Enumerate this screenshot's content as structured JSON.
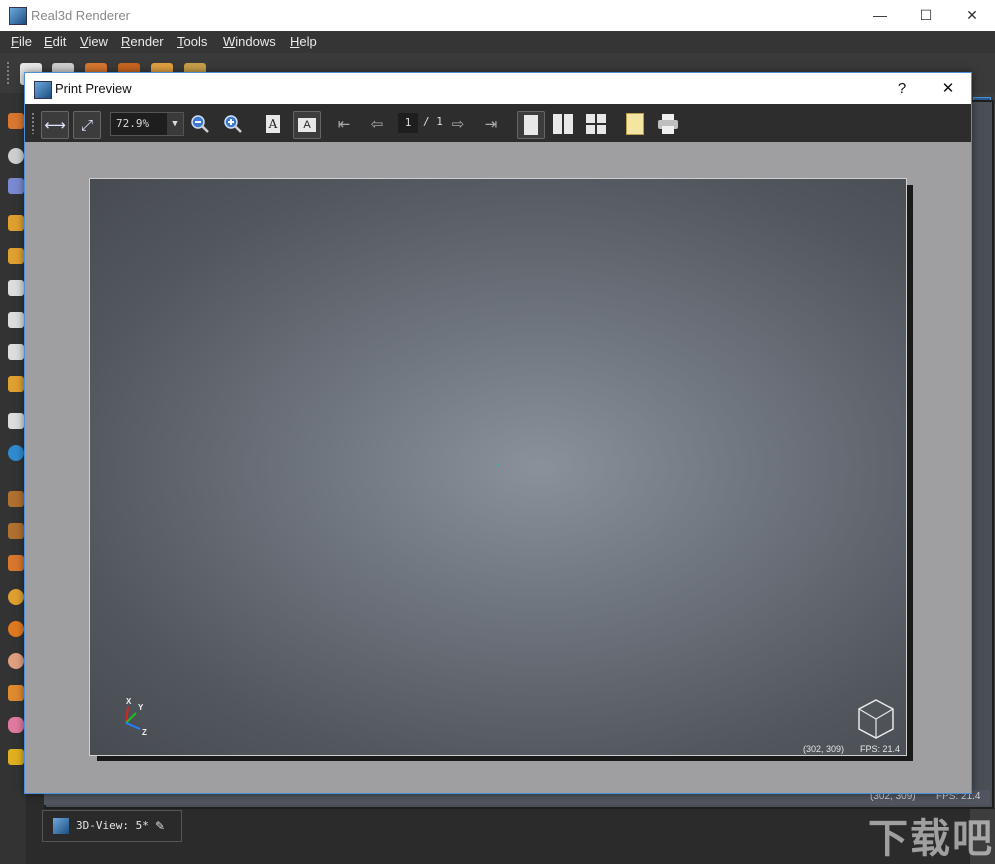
{
  "app": {
    "title": "Real3d Renderer",
    "window_controls": {
      "minimize": "—",
      "maximize": "☐",
      "close": "✕"
    }
  },
  "menu": [
    "File",
    "Edit",
    "View",
    "Render",
    "Tools",
    "Windows",
    "Help"
  ],
  "menu_mnemonics": [
    "F",
    "E",
    "V",
    "R",
    "T",
    "W",
    "H"
  ],
  "dialog": {
    "title": "Print Preview",
    "help_label": "?",
    "close_label": "✕",
    "toolbar": {
      "zoom_value": "72.9%",
      "current_page": "1",
      "page_total": "/ 1"
    }
  },
  "page_view": {
    "axes": {
      "x": "X",
      "y": "Y",
      "z": "Z"
    },
    "coords": "(302, 309)",
    "fps": "FPS: 21.4"
  },
  "background_view": {
    "coords": "(302, 309)",
    "fps": "FPS: 21.4"
  },
  "bottom_tab": {
    "label": "3D-View: 5*"
  },
  "watermark": "下载吧",
  "colors": {
    "accent": "#4a90d9",
    "toolbar_bg": "#2d2d2d",
    "page_border": "#cfcfcf"
  }
}
